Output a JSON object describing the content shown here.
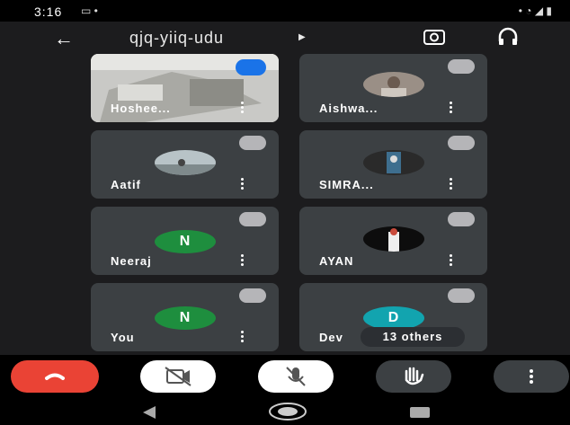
{
  "status_bar": {
    "time": "3:16"
  },
  "header": {
    "meeting_code": "qjq-yiiq-udu"
  },
  "participants": [
    {
      "name": "Hoshee..."
    },
    {
      "name": "Aishwa..."
    },
    {
      "name": "Aatif"
    },
    {
      "name": "SIMRA..."
    },
    {
      "name": "Neeraj",
      "initial": "N",
      "avatar_color": "#1e8e3e"
    },
    {
      "name": "AYAN"
    },
    {
      "name": "You",
      "initial": "N",
      "avatar_color": "#1e8e3e"
    },
    {
      "name": "Dev",
      "initial": "D",
      "avatar_color": "#12a4af"
    }
  ],
  "others_pill": {
    "label": "13 others"
  },
  "colors": {
    "end_call": "#ea4335",
    "tile_bg": "#3c4043",
    "screen_bg": "#1c1c1e"
  }
}
